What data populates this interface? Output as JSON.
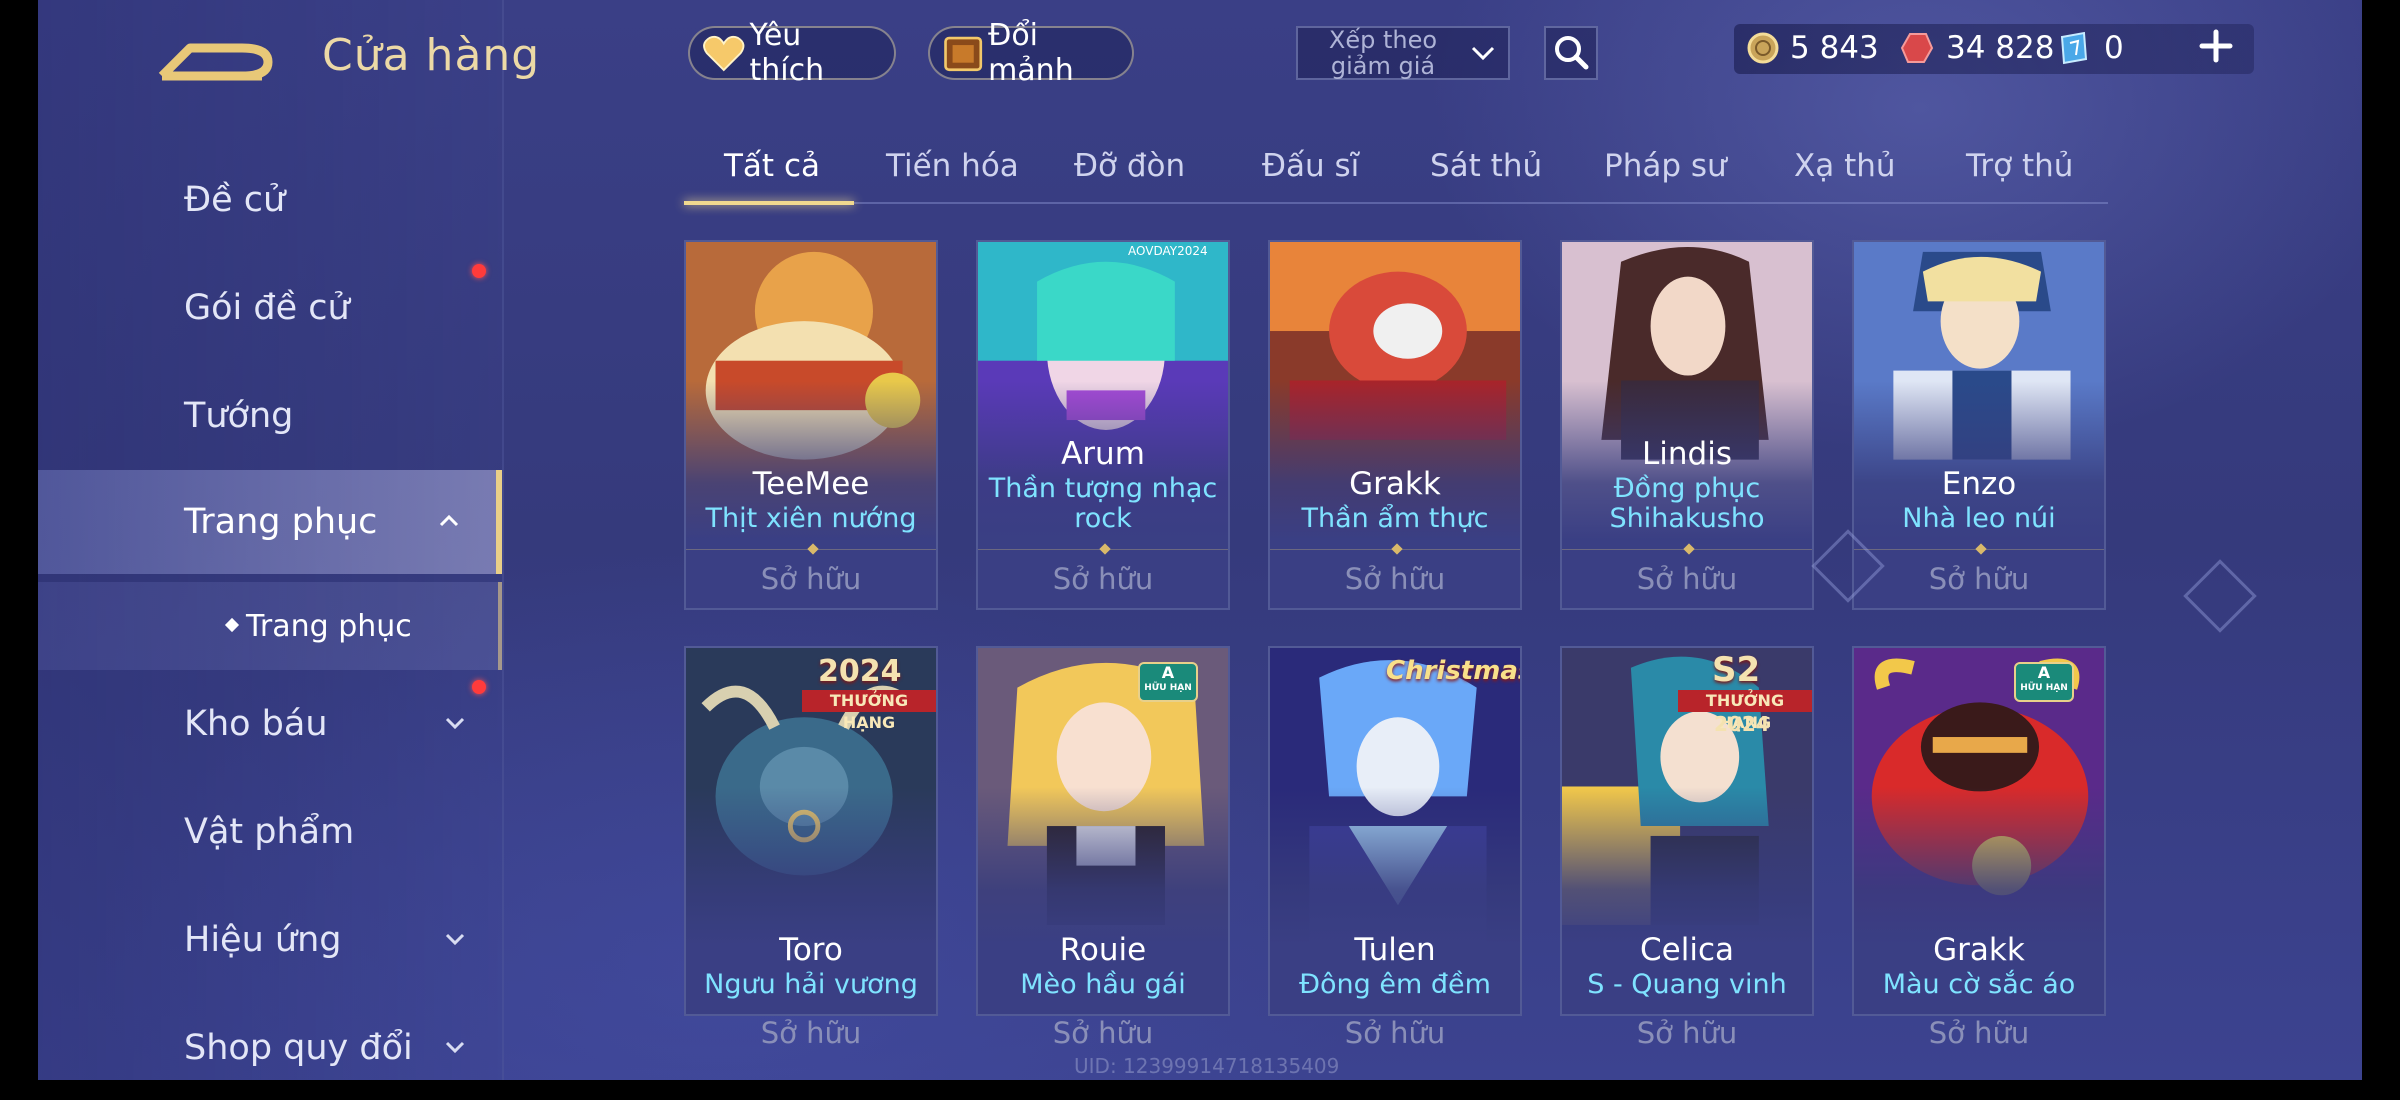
{
  "header": {
    "title": "Cửa hàng",
    "favorite_label": "Yêu thích",
    "exchange_label": "Đổi mảnh",
    "sort_label": "Xếp theo giảm giá",
    "currencies": [
      {
        "name": "gold",
        "value": "5 843"
      },
      {
        "name": "voucher",
        "value": "34 828"
      },
      {
        "name": "diamond",
        "value": "0"
      }
    ]
  },
  "sidebar": {
    "items": [
      {
        "label": "Đề cử",
        "badge": false
      },
      {
        "label": "Gói đề cử",
        "badge": true
      },
      {
        "label": "Tướng",
        "badge": false
      },
      {
        "label": "Trang phục",
        "badge": false,
        "expanded": true
      },
      {
        "label": "Kho báu",
        "badge": true
      },
      {
        "label": "Vật phẩm",
        "badge": false
      },
      {
        "label": "Hiệu ứng",
        "badge": false
      },
      {
        "label": "Shop quy đổi",
        "badge": false
      }
    ],
    "sub_item": "Trang phục"
  },
  "tabs": [
    "Tất cả",
    "Tiến hóa",
    "Đỡ đòn",
    "Đấu sĩ",
    "Sát thủ",
    "Pháp sư",
    "Xạ thủ",
    "Trợ thủ"
  ],
  "active_tab": "Tất cả",
  "cards": [
    {
      "hero": "TeeMee",
      "skin": "Thịt xiên nướng",
      "status": "Sở hữu",
      "colors": [
        "#d9a24a",
        "#f3e6c8",
        "#9c4a2a"
      ]
    },
    {
      "hero": "Arum",
      "skin": "Thần tượng nhạc rock",
      "status": "Sở hữu",
      "tag": "AOVDAY2024",
      "colors": [
        "#2fb7c9",
        "#a64bd6",
        "#f0c6e6"
      ]
    },
    {
      "hero": "Grakk",
      "skin": "Thần ẩm thực",
      "status": "Sở hữu",
      "colors": [
        "#d94a3a",
        "#f08a3a",
        "#3a2a40"
      ]
    },
    {
      "hero": "Lindis",
      "skin": "Đồng phục Shihakusho",
      "status": "Sở hữu",
      "colors": [
        "#e8d8e8",
        "#4a3a4a",
        "#c8a8b8"
      ]
    },
    {
      "hero": "Enzo",
      "skin": "Nhà leo núi",
      "status": "Sở hữu",
      "colors": [
        "#3a5aa8",
        "#dfe6f5",
        "#f2e0b0"
      ]
    },
    {
      "hero": "Toro",
      "skin": "Ngưu hải vương",
      "status": "Sở hữu",
      "badge_year": "2024",
      "badge_text": "THƯỞNG HẠNG",
      "colors": [
        "#2a4a6a",
        "#4a8aa8",
        "#1a2a40"
      ]
    },
    {
      "hero": "Rouie",
      "skin": "Mèo hầu gái",
      "status": "Sở hữu",
      "badge_small": "A",
      "badge_small_text": "HỮU HẠN",
      "colors": [
        "#f2c85a",
        "#3a2a2a",
        "#f0e0d0"
      ]
    },
    {
      "hero": "Tulen",
      "skin": "Đông êm đềm",
      "status": "Sở hữu",
      "badge_event": "Christmas",
      "colors": [
        "#3a6ad8",
        "#a8d8f8",
        "#2a2a7a"
      ]
    },
    {
      "hero": "Celica",
      "skin": "S - Quang vinh",
      "status": "Sở hữu",
      "badge_year": "S2",
      "badge_text": "THƯỞNG HẠNG",
      "badge_sub": "2024",
      "colors": [
        "#f2c84a",
        "#2a8aa8",
        "#3a2a4a"
      ]
    },
    {
      "hero": "Grakk",
      "skin": "Màu cờ sắc áo",
      "status": "Sở hữu",
      "badge_small": "A",
      "badge_small_text": "HỮU HẠN",
      "colors": [
        "#d92a2a",
        "#f2c84a",
        "#5a1a1a"
      ]
    }
  ],
  "uid_text": "UID: 12399914718135409"
}
